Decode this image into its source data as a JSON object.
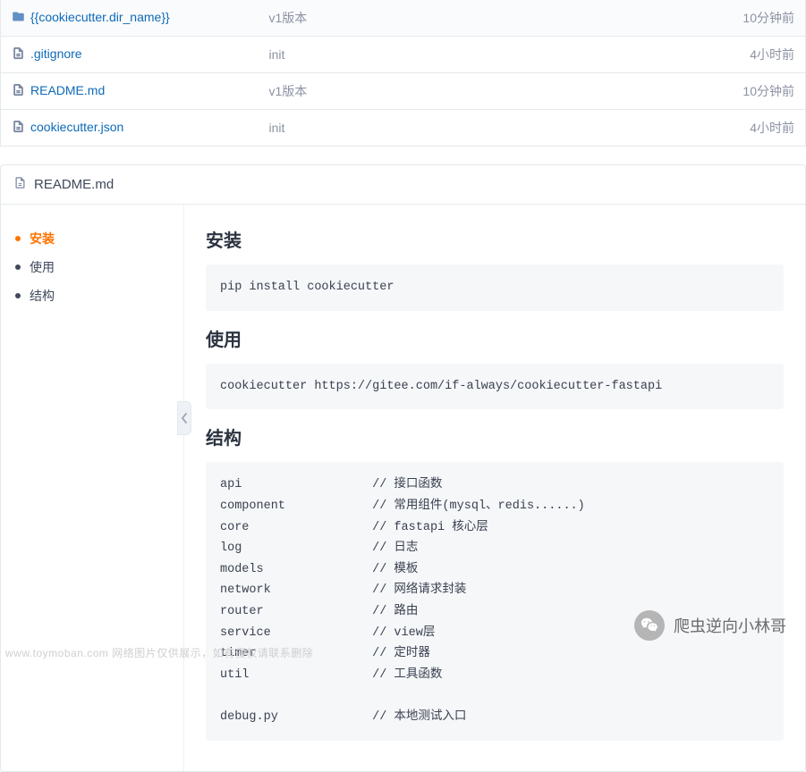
{
  "files": [
    {
      "kind": "folder",
      "name": "{{cookiecutter.dir_name}}",
      "msg": "v1版本",
      "time": "10分钟前"
    },
    {
      "kind": "file",
      "name": ".gitignore",
      "msg": "init",
      "time": "4小时前"
    },
    {
      "kind": "file",
      "name": "README.md",
      "msg": "v1版本",
      "time": "10分钟前"
    },
    {
      "kind": "file",
      "name": "cookiecutter.json",
      "msg": "init",
      "time": "4小时前"
    }
  ],
  "readme": {
    "filename": "README.md",
    "toc": [
      {
        "label": "安装",
        "active": true
      },
      {
        "label": "使用",
        "active": false
      },
      {
        "label": "结构",
        "active": false
      }
    ],
    "sections": {
      "install": {
        "title": "安装",
        "code": "pip install cookiecutter"
      },
      "usage": {
        "title": "使用",
        "code": "cookiecutter https://gitee.com/if-always/cookiecutter-fastapi"
      },
      "structure": {
        "title": "结构",
        "code": "api                  // 接口函数\ncomponent            // 常用组件(mysql、redis......)\ncore                 // fastapi 核心层\nlog                  // 日志\nmodels               // 模板\nnetwork              // 网络请求封装\nrouter               // 路由\nservice              // view层\ntimer                // 定时器\nutil                 // 工具函数\n\ndebug.py             // 本地测试入口"
      }
    }
  },
  "watermark": "www.toymoban.com 网络图片仅供展示，如有侵权请联系删除",
  "wechat_label": "爬虫逆向小林哥"
}
